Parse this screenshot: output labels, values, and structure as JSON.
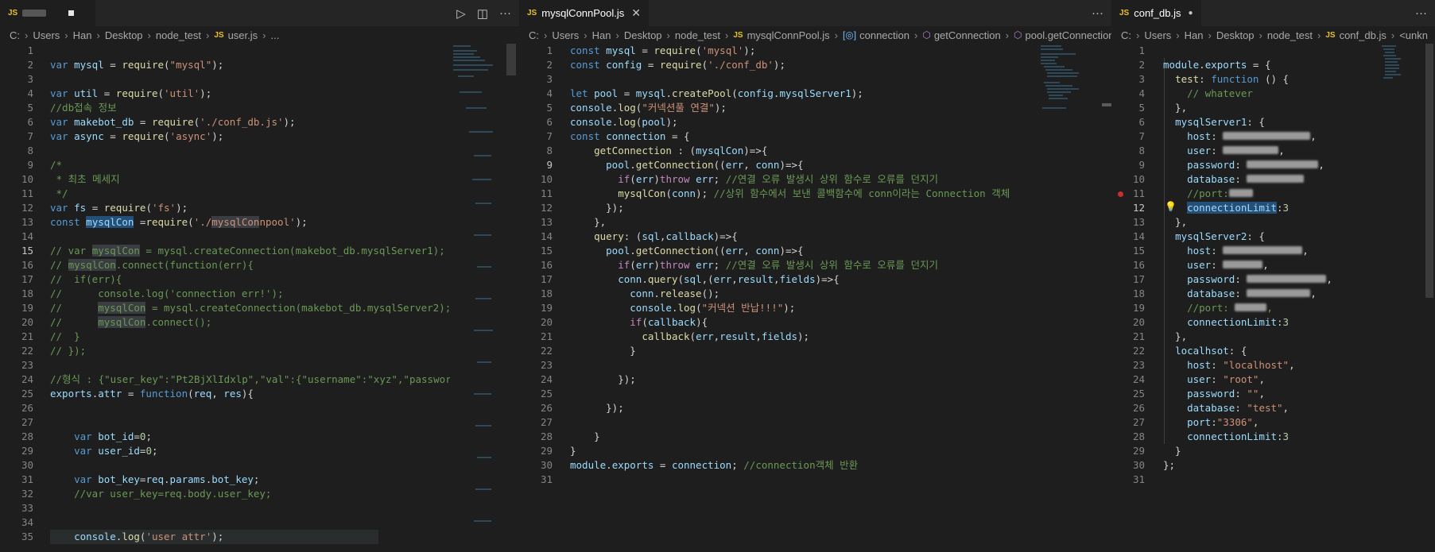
{
  "pane1": {
    "tab": {
      "js": "JS",
      "active": true
    },
    "actions": {
      "run": "▷",
      "split": "◫",
      "more": "···"
    },
    "breadcrumb": [
      "C:",
      "Users",
      "Han",
      "Desktop",
      "node_test"
    ],
    "breadcrumb_file": "user.js",
    "breadcrumb_tail": "...",
    "current_line": 15
  },
  "pane2": {
    "tab": {
      "js": "JS",
      "label": "mysqlConnPool.js",
      "close": "✕"
    },
    "actions": {
      "more": "···"
    },
    "breadcrumb": [
      "C:",
      "Users",
      "Han",
      "Desktop",
      "node_test"
    ],
    "breadcrumb_file": "mysqlConnPool.js",
    "breadcrumb_symbols": [
      "connection",
      "getConnection",
      "pool.getConnection() ca"
    ],
    "current_line": 9
  },
  "pane3": {
    "tab": {
      "js": "JS",
      "label": "conf_db.js",
      "dirty": "●"
    },
    "actions": {
      "more": "···"
    },
    "breadcrumb": [
      "C:",
      "Users",
      "Han",
      "Desktop",
      "node_test"
    ],
    "breadcrumb_file": "conf_db.js",
    "breadcrumb_symbols": [
      "<unkn"
    ],
    "current_line": 12
  },
  "colors": {
    "background": "#1e1e1e",
    "keyword": "#569cd6",
    "variable": "#9cdcfe",
    "string": "#ce9178",
    "comment": "#6a9955",
    "function": "#dcdcaa",
    "number": "#b5cea8"
  }
}
